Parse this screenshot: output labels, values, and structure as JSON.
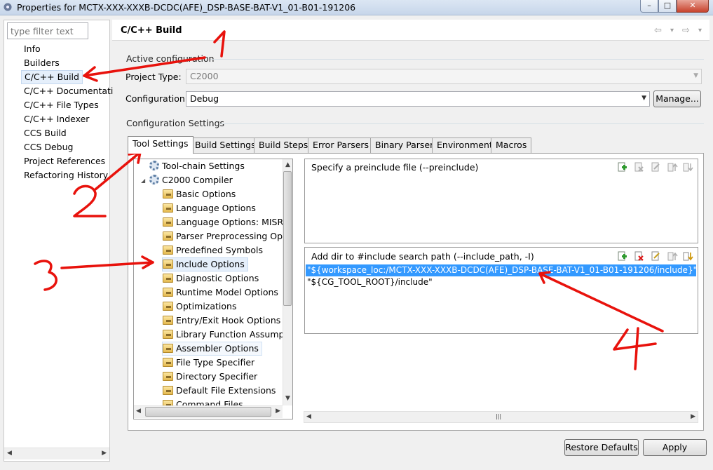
{
  "window": {
    "title": "Properties for MCTX-XXX-XXXB-DCDC(AFE)_DSP-BASE-BAT-V1_01-B01-191206",
    "minimize_glyph": "–",
    "maximize_glyph": "□",
    "close_glyph": "✕"
  },
  "sidebar": {
    "filter_placeholder": "type filter text",
    "items": [
      {
        "label": "Info"
      },
      {
        "label": "Builders"
      },
      {
        "label": "C/C++ Build",
        "selected": true
      },
      {
        "label": "C/C++ Documentati"
      },
      {
        "label": "C/C++ File Types"
      },
      {
        "label": "C/C++ Indexer"
      },
      {
        "label": "CCS Build"
      },
      {
        "label": "CCS Debug"
      },
      {
        "label": "Project References"
      },
      {
        "label": "Refactoring History"
      }
    ]
  },
  "header": {
    "title": "C/C++ Build",
    "back_glyph": "⇦",
    "forward_glyph": "⇨",
    "dropdown_glyph": "▾"
  },
  "active_config": {
    "group_label": "Active configuration",
    "project_type_label": "Project Type:",
    "project_type_value": "C2000",
    "configuration_label": "Configuration:",
    "configuration_value": "Debug",
    "manage_button": "Manage..."
  },
  "config_settings": {
    "group_label": "Configuration Settings",
    "tabs": [
      {
        "label": "Tool Settings",
        "active": true
      },
      {
        "label": "Build Settings"
      },
      {
        "label": "Build Steps"
      },
      {
        "label": "Error Parsers"
      },
      {
        "label": "Binary Parser"
      },
      {
        "label": "Environment"
      },
      {
        "label": "Macros"
      }
    ]
  },
  "tree": {
    "items": [
      {
        "label": "Tool-chain Settings",
        "level": 0,
        "icon": "gear-icon"
      },
      {
        "label": "C2000 Compiler",
        "level": 0,
        "icon": "gear-icon",
        "expanded": true
      },
      {
        "label": "Basic Options",
        "level": 1,
        "icon": "folder-icon"
      },
      {
        "label": "Language Options",
        "level": 1,
        "icon": "folder-icon"
      },
      {
        "label": "Language Options: MISRA",
        "level": 1,
        "icon": "folder-icon"
      },
      {
        "label": "Parser Preprocessing Opt",
        "level": 1,
        "icon": "folder-icon"
      },
      {
        "label": "Predefined Symbols",
        "level": 1,
        "icon": "folder-icon"
      },
      {
        "label": "Include Options",
        "level": 1,
        "icon": "folder-icon",
        "selected": true
      },
      {
        "label": "Diagnostic Options",
        "level": 1,
        "icon": "folder-icon"
      },
      {
        "label": "Runtime Model Options",
        "level": 1,
        "icon": "folder-icon"
      },
      {
        "label": "Optimizations",
        "level": 1,
        "icon": "folder-icon"
      },
      {
        "label": "Entry/Exit Hook Options",
        "level": 1,
        "icon": "folder-icon"
      },
      {
        "label": "Library Function Assumpti",
        "level": 1,
        "icon": "folder-icon"
      },
      {
        "label": "Assembler Options",
        "level": 1,
        "icon": "folder-icon",
        "hover": true
      },
      {
        "label": "File Type Specifier",
        "level": 1,
        "icon": "folder-icon"
      },
      {
        "label": "Directory Specifier",
        "level": 1,
        "icon": "folder-icon"
      },
      {
        "label": "Default File Extensions",
        "level": 1,
        "icon": "folder-icon"
      },
      {
        "label": "Command Files",
        "level": 1,
        "icon": "folder-icon"
      }
    ]
  },
  "preinclude": {
    "title": "Specify a preinclude file (--preinclude)",
    "items": []
  },
  "include_path": {
    "title": "Add dir to #include search path (--include_path, -I)",
    "items": [
      {
        "value": "\"${workspace_loc:/MCTX-XXX-XXXB-DCDC(AFE)_DSP-BASE-BAT-V1_01-B01-191206/include}\"",
        "selected": true
      },
      {
        "value": "\"${CG_TOOL_ROOT}/include\""
      }
    ]
  },
  "footer": {
    "restore_defaults": "Restore Defaults",
    "apply": "Apply"
  },
  "colors": {
    "selection": "#3399ff",
    "annotation_red": "#e8120c"
  }
}
